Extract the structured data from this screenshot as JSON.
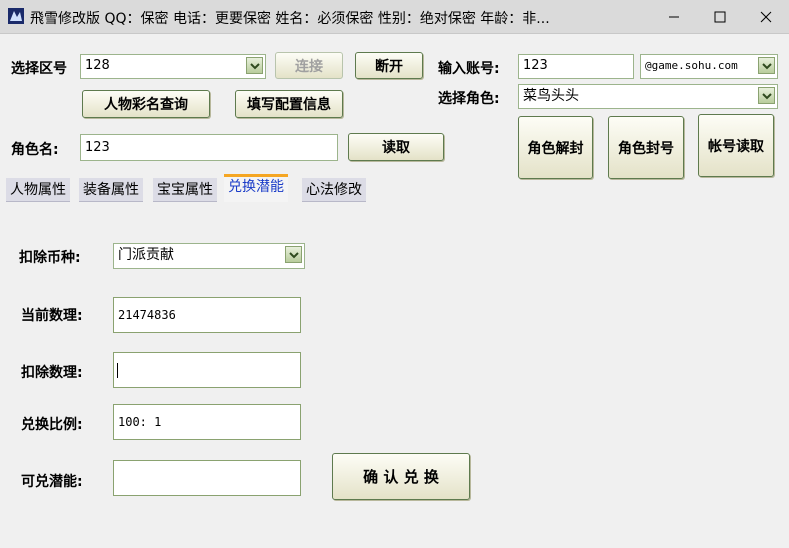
{
  "window": {
    "title": "飛雪修改版 QQ：保密 电话：更要保密 姓名：必须保密 性别：绝对保密 年龄：非...",
    "icon": "app-logo-icon"
  },
  "top": {
    "region_label": "选择区号",
    "region_value": "128",
    "connect_label": "连接",
    "disconnect_label": "断开",
    "query_color_name_label": "人物彩名查询",
    "fill_config_label": "填写配置信息",
    "role_name_label": "角色名:",
    "role_name_value": "123",
    "read_label": "读取"
  },
  "account": {
    "input_label": "输入账号:",
    "input_value": "123",
    "domain_value": "@game.sohu.com",
    "role_label": "选择角色:",
    "role_value": "菜鸟头头",
    "unseal_label": "角色解封",
    "ban_label": "角色封号",
    "account_read_label": "帐号读取"
  },
  "tabs": [
    "人物属性",
    "装备属性",
    "宝宝属性",
    "兑换潜能",
    "心法修改"
  ],
  "active_tab": "兑换潜能",
  "exchange": {
    "currency_label": "扣除币种:",
    "currency_value": "门派贡献",
    "current_label": "当前数理:",
    "current_value": "21474836",
    "deduct_label": "扣除数理:",
    "deduct_value": "",
    "ratio_label": "兑换比例:",
    "ratio_value": "100: 1",
    "potential_label": "可兑潜能:",
    "potential_value": "",
    "confirm_label": "确 认 兑 换"
  },
  "colors": {
    "accent_tab": "#f5a623",
    "active_tab_text": "#1a3cc8",
    "field_border": "#9cb48c"
  }
}
